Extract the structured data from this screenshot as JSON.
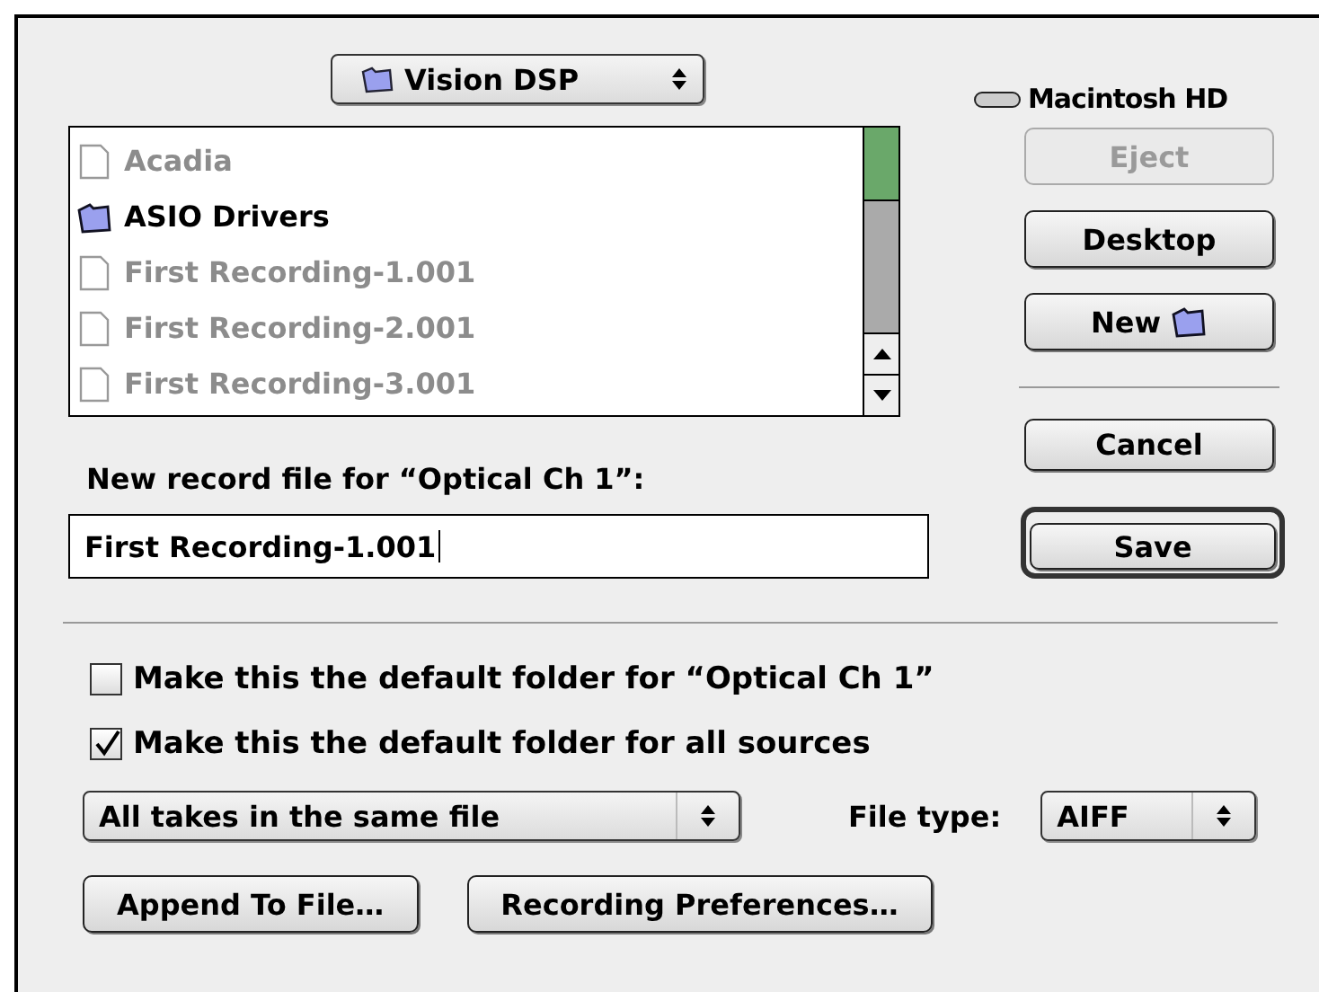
{
  "folder_popup": {
    "label": "Vision DSP"
  },
  "volume": {
    "label": "Macintosh HD"
  },
  "files": [
    {
      "name": "Acadia",
      "kind": "file",
      "disabled": true
    },
    {
      "name": "ASIO Drivers",
      "kind": "folder",
      "disabled": false
    },
    {
      "name": "First Recording-1.001",
      "kind": "file",
      "disabled": true
    },
    {
      "name": "First Recording-2.001",
      "kind": "file",
      "disabled": true
    },
    {
      "name": "First Recording-3.001",
      "kind": "file",
      "disabled": true
    }
  ],
  "side_buttons": [
    {
      "label": "Eject",
      "disabled": true,
      "kind": "plain"
    },
    {
      "label": "Desktop",
      "disabled": false,
      "kind": "plain"
    },
    {
      "label": "New",
      "disabled": false,
      "kind": "folder"
    }
  ],
  "prompt": "New record file for “Optical Ch 1”:",
  "file_name": {
    "value": "First Recording-1.001"
  },
  "cancel_button": "Cancel",
  "save_button": "Save",
  "checkboxes": [
    {
      "label": "Make this the default folder for “Optical Ch 1”",
      "checked": false
    },
    {
      "label": "Make this the default folder for all sources",
      "checked": true
    }
  ],
  "takes_popup": {
    "value": "All takes in the same file"
  },
  "file_type": {
    "label": "File type:",
    "value": "AIFF"
  },
  "bottom_buttons": [
    "Append To File…",
    "Recording Preferences…"
  ]
}
